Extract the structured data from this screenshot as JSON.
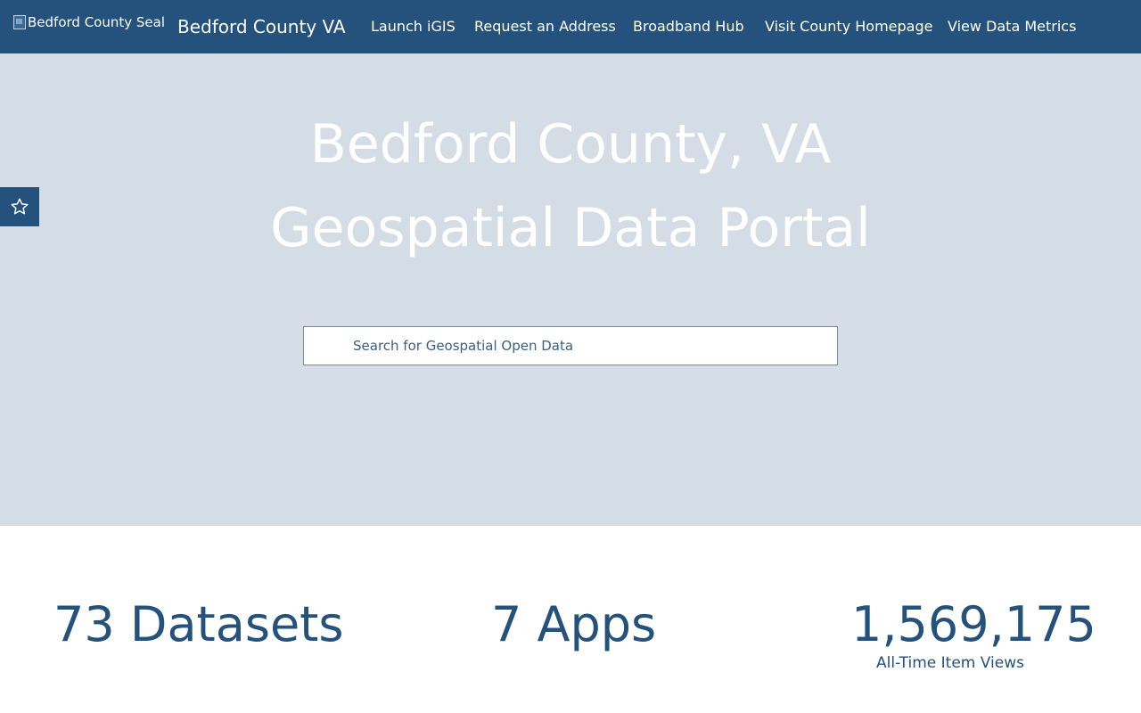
{
  "header": {
    "seal_alt": "Bedford County Seal",
    "site_title": "Bedford County VA",
    "nav": [
      {
        "label": "Launch iGIS"
      },
      {
        "label": "Request an Address"
      },
      {
        "label": "Broadband Hub"
      },
      {
        "label": "Visit County Homepage"
      },
      {
        "label": "View Data Metrics"
      }
    ]
  },
  "hero": {
    "title_line1": "Bedford County, VA",
    "title_line2": "Geospatial Data Portal",
    "search_placeholder": "Search for Geospatial Open Data",
    "favorites_icon": "star-icon"
  },
  "stats": {
    "datasets": "73 Datasets",
    "apps": "7 Apps",
    "views_value": "1,569,175",
    "views_label": "All-Time Item Views"
  },
  "colors": {
    "primary": "#24527c",
    "hero_bg": "#d4dce5",
    "white": "#ffffff"
  }
}
